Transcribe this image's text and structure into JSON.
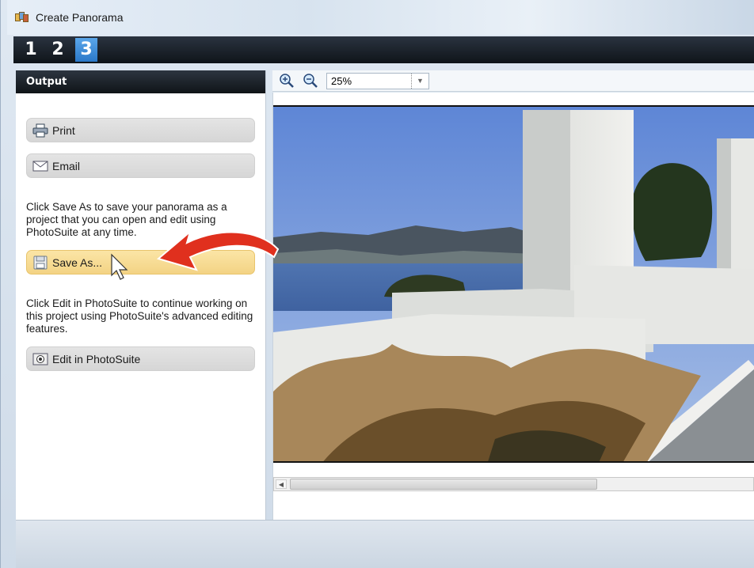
{
  "window": {
    "title": "Create Panorama"
  },
  "steps": [
    "1",
    "2",
    "3"
  ],
  "active_step": "3",
  "output_panel": {
    "header": "Output",
    "print_label": "Print",
    "email_label": "Email",
    "save_description": "Click Save As to save your panorama as a project that you can open and edit using PhotoSuite at any time.",
    "save_as_label": "Save As...",
    "edit_description": "Click Edit in PhotoSuite to continue working on this project using PhotoSuite's advanced editing features.",
    "edit_label": "Edit in PhotoSuite"
  },
  "toolbar": {
    "zoom_value": "25%"
  },
  "colors": {
    "accent_step": "#2a78c8",
    "highlight": "#f3d384",
    "callout_arrow": "#e0301e"
  },
  "icons": [
    "zoom-in-icon",
    "zoom-out-icon",
    "printer-icon",
    "envelope-icon",
    "save-icon",
    "photosuite-icon",
    "dropdown-arrow-icon"
  ]
}
